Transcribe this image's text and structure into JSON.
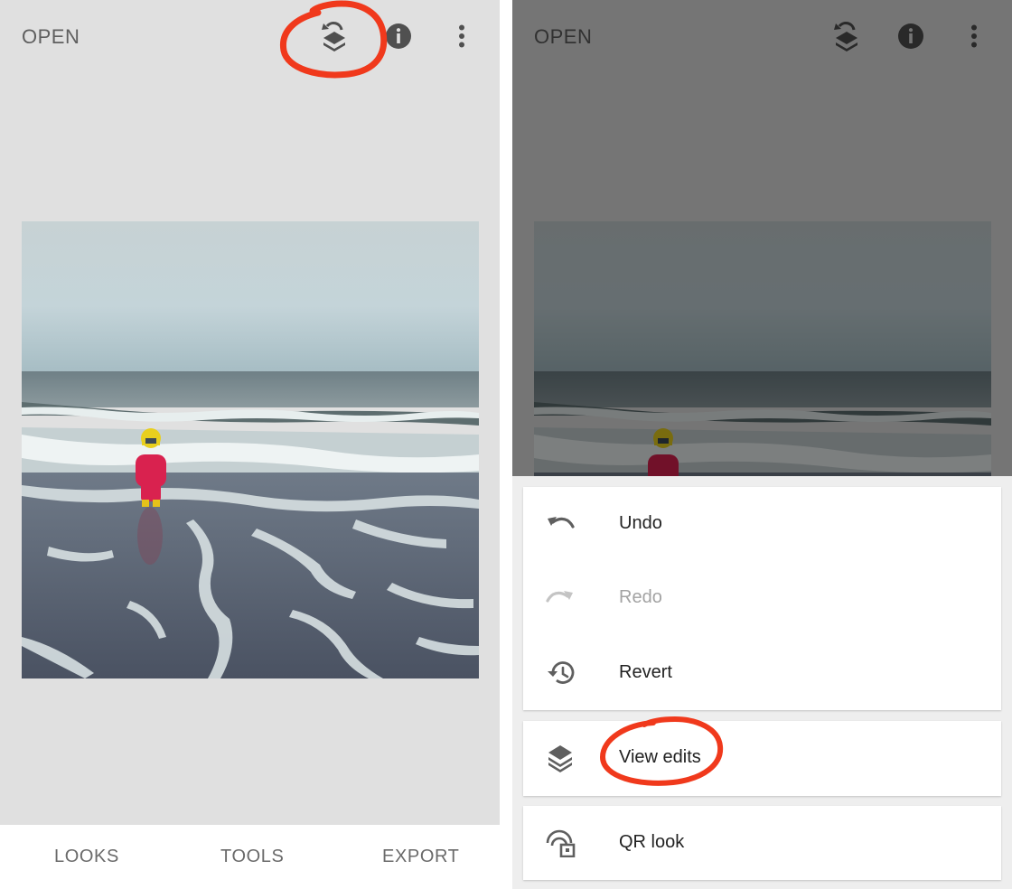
{
  "left_screen": {
    "topbar": {
      "open_label": "OPEN"
    },
    "bottom_nav": {
      "looks": "LOOKS",
      "tools": "TOOLS",
      "export": "EXPORT"
    },
    "icons": {
      "history": "layers-undo-icon",
      "info": "info-icon",
      "more": "more-vert-icon"
    }
  },
  "right_screen": {
    "topbar": {
      "open_label": "OPEN"
    },
    "menu": {
      "undo": "Undo",
      "redo": "Redo",
      "revert": "Revert",
      "view_edits": "View edits",
      "qr_look": "QR look"
    },
    "icons": {
      "undo": "undo-icon",
      "redo": "redo-icon",
      "revert": "history-icon",
      "view_edits": "layers-icon",
      "qr_look": "qr-look-icon"
    }
  },
  "colors": {
    "background": "#e0e0e0",
    "annotation": "#f0391c",
    "text_primary": "#222222",
    "text_disabled": "#a3a3a3",
    "icon": "#5f5f5f"
  }
}
